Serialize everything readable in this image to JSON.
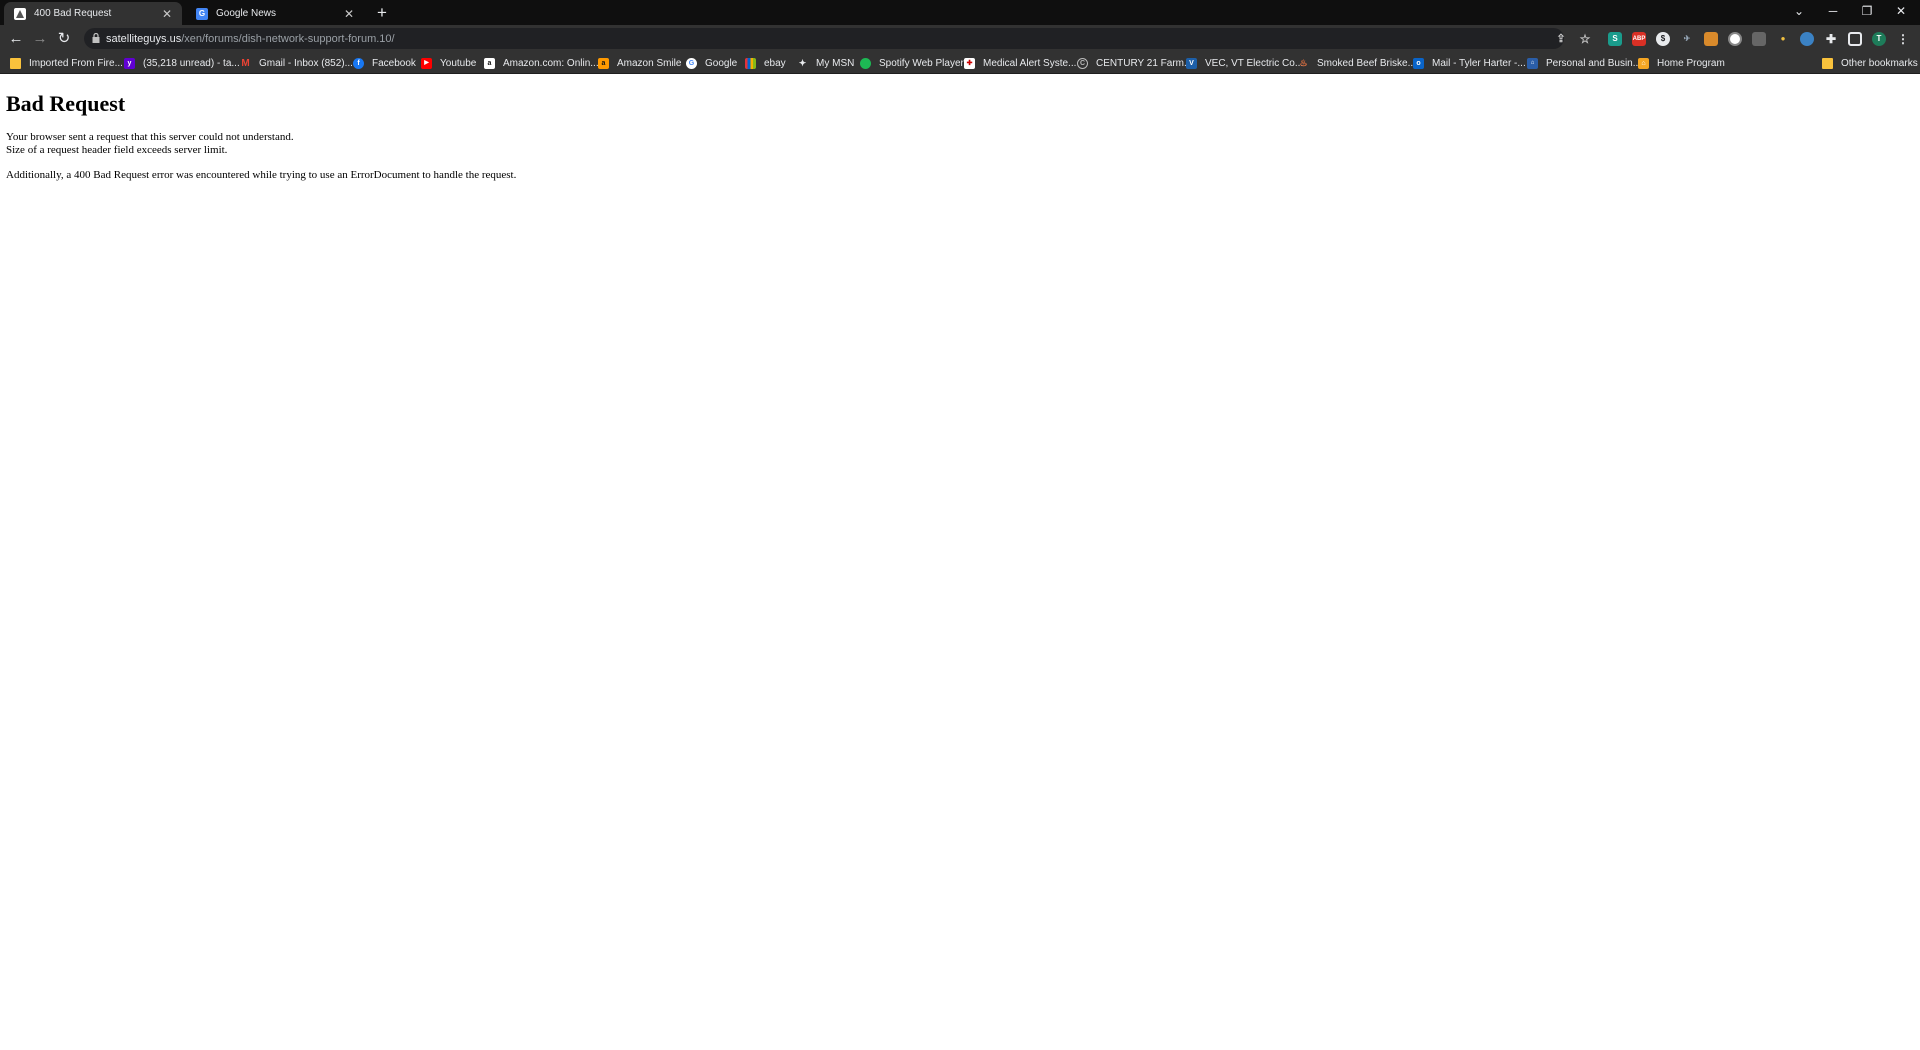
{
  "tabs": [
    {
      "title": "400 Bad Request",
      "icon": "satelliteguys-favicon-icon",
      "active": true
    },
    {
      "title": "Google News",
      "icon": "google-news-icon",
      "active": false
    }
  ],
  "address_bar": {
    "host": "satelliteguys.us",
    "path": "/xen/forums/dish-network-support-forum.10/"
  },
  "bookmarks": [
    {
      "label": "Imported From Fire...",
      "icon": "folder-icon"
    },
    {
      "label": "(35,218 unread) - ta...",
      "icon": "yahoo-mail-icon"
    },
    {
      "label": "Gmail - Inbox (852)...",
      "icon": "gmail-icon"
    },
    {
      "label": "Facebook",
      "icon": "facebook-icon"
    },
    {
      "label": "Youtube",
      "icon": "youtube-icon"
    },
    {
      "label": "Amazon.com: Onlin...",
      "icon": "amazon-icon"
    },
    {
      "label": "Amazon Smile",
      "icon": "amazon-smile-icon"
    },
    {
      "label": "Google",
      "icon": "google-icon"
    },
    {
      "label": "ebay",
      "icon": "ebay-icon"
    },
    {
      "label": "My MSN",
      "icon": "msn-icon"
    },
    {
      "label": "Spotify Web Player",
      "icon": "spotify-icon"
    },
    {
      "label": "Medical Alert Syste...",
      "icon": "medical-alert-icon"
    },
    {
      "label": "CENTURY 21 Farm...",
      "icon": "century21-icon"
    },
    {
      "label": "VEC, VT Electric Co...",
      "icon": "vec-icon"
    },
    {
      "label": "Smoked Beef Briske...",
      "icon": "recipe-icon"
    },
    {
      "label": "Mail - Tyler Harter -...",
      "icon": "outlook-icon"
    },
    {
      "label": "Personal and Busin...",
      "icon": "bank-icon"
    },
    {
      "label": "Home Program",
      "icon": "home-program-icon"
    }
  ],
  "other_bookmarks": "Other bookmarks",
  "profile_initial": "T",
  "page": {
    "heading": "Bad Request",
    "line1": "Your browser sent a request that this server could not understand.",
    "line2": "Size of a request header field exceeds server limit.",
    "line3": "Additionally, a 400 Bad Request error was encountered while trying to use an ErrorDocument to handle the request."
  },
  "colors": {
    "tabstrip_bg": "#0f0f0f",
    "toolbar_bg": "#323232",
    "omnibox_bg": "#202124"
  }
}
